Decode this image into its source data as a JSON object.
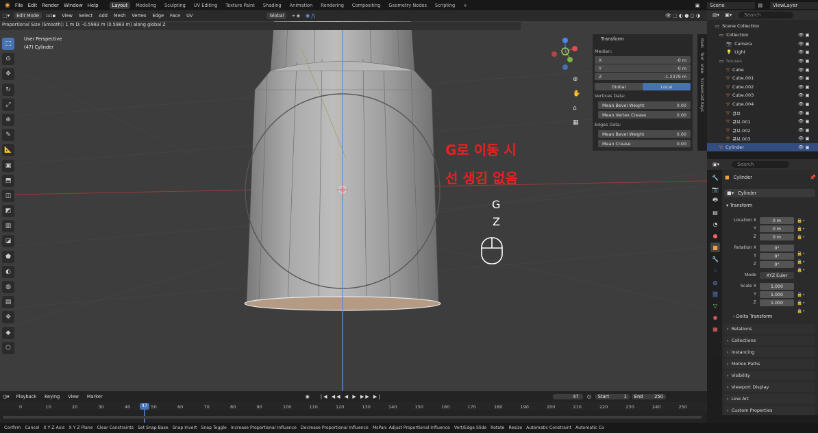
{
  "menu": [
    "File",
    "Edit",
    "Render",
    "Window",
    "Help"
  ],
  "workspaces": [
    "Layout",
    "Modeling",
    "Sculpting",
    "UV Editing",
    "Texture Paint",
    "Shading",
    "Animation",
    "Rendering",
    "Compositing",
    "Geometry Nodes",
    "Scripting",
    "+"
  ],
  "top_right": {
    "scene": "Scene",
    "view_layer": "ViewLayer"
  },
  "header": {
    "mode": "Edit Mode",
    "menus": [
      "View",
      "Select",
      "Add",
      "Mesh",
      "Vertex",
      "Edge",
      "Face",
      "UV"
    ],
    "orientation": "Global"
  },
  "status_line": "Proportional Size (Smooth): 1 m   D: -0.5983 m (0.5983 m) along global Z",
  "viewport": {
    "perspective": "User Perspective",
    "object": "(47) Cylinder"
  },
  "annotation": {
    "line1": "G로 이동 시",
    "line2": "선 생김 없음",
    "key1": "G",
    "key2": "Z"
  },
  "colors": {
    "annotation": "#e52222",
    "selected": "#4772b3",
    "bg": "#3d3d3d"
  },
  "npanel": {
    "title": "Transform",
    "median": "Median:",
    "x_label": "X",
    "x": "-0 m",
    "y_label": "Y",
    "y": "-0 m",
    "z_label": "Z",
    "z": "-1.2379 m",
    "global": "Global",
    "local": "Local",
    "vertices_data": "Vertices Data:",
    "mean_bevel_weight": "Mean Bevel Weight",
    "mbw_val": "0.00",
    "mean_vertex_crease": "Mean Vertex Crease",
    "mvc_val": "0.00",
    "edges_data": "Edges Data:",
    "mean_bevel_weight_e": "Mean Bevel Weight",
    "mbwe_val": "0.00",
    "mean_crease": "Mean Crease",
    "mc_val": "0.00"
  },
  "side_tabs": [
    "Item",
    "Tool",
    "View",
    "Screencast Keys"
  ],
  "outliner": {
    "search": "Search",
    "scene_collection": "Scene Collection",
    "items": [
      {
        "name": "Collection",
        "indent": 1
      },
      {
        "name": "Camera",
        "indent": 2
      },
      {
        "name": "Light",
        "indent": 2
      },
      {
        "name": "houses",
        "indent": 1
      },
      {
        "name": "Cube",
        "indent": 2
      },
      {
        "name": "Cube.001",
        "indent": 2
      },
      {
        "name": "Cube.002",
        "indent": 2
      },
      {
        "name": "Cube.003",
        "indent": 2
      },
      {
        "name": "Cube.004",
        "indent": 2
      },
      {
        "name": "큐브",
        "indent": 2
      },
      {
        "name": "큐브.001",
        "indent": 2
      },
      {
        "name": "큐브.002",
        "indent": 2
      },
      {
        "name": "큐브.003",
        "indent": 2
      },
      {
        "name": "Cylinder",
        "indent": 1,
        "selected": true
      }
    ]
  },
  "properties": {
    "search": "Search",
    "object_name": "Cylinder",
    "data_name": "Cylinder",
    "transform": "Transform",
    "location_label": "Location X",
    "loc_x": "0 m",
    "loc_y": "0 m",
    "loc_z": "0 m",
    "rotation_label": "Rotation X",
    "rot_x": "0°",
    "rot_y": "0°",
    "rot_z": "0°",
    "mode_label": "Mode",
    "mode": "XYZ Euler",
    "scale_label": "Scale X",
    "scale_x": "1.000",
    "scale_y": "1.000",
    "scale_z": "1.000",
    "y": "Y",
    "z": "Z",
    "delta": "Delta Transform",
    "sections": [
      "Relations",
      "Collections",
      "Instancing",
      "Motion Paths",
      "Visibility",
      "Viewport Display",
      "Line Art",
      "Custom Properties"
    ]
  },
  "timeline": {
    "menus": [
      "Playback",
      "Keying",
      "View",
      "Marker"
    ],
    "current": "47",
    "start_label": "Start",
    "start": "1",
    "end_label": "End",
    "end": "250",
    "ticks": [
      "0",
      "10",
      "20",
      "30",
      "40",
      "50",
      "60",
      "70",
      "80",
      "90",
      "100",
      "110",
      "120",
      "130",
      "140",
      "150",
      "160",
      "170",
      "180",
      "190",
      "200",
      "210",
      "220",
      "230",
      "240",
      "250"
    ]
  },
  "statusbar": [
    "Confirm",
    "Cancel",
    "X Y Z Axis",
    "X Y Z Plane",
    "Clear Constraints",
    "Set Snap Base",
    "Snap Invert",
    "Snap Toggle",
    "Increase Proportional Influence",
    "Decrease Proportional Influence",
    "MsPan: Adjust Proportional Influence",
    "Vert/Edge Slide",
    "Rotate",
    "Resize",
    "Automatic Constraint",
    "Automatic Co"
  ]
}
